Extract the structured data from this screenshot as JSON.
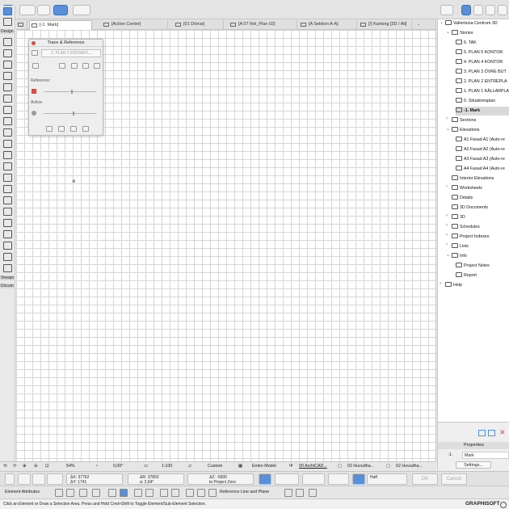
{
  "tabs": [
    {
      "label": "[-1. Mark]",
      "active": true
    },
    {
      "label": "[Action Center]"
    },
    {
      "label": "[01 Dörrar]"
    },
    {
      "label": "[A 07 Rel_Plan 02]"
    },
    {
      "label": "[A Sektion A-A]"
    },
    {
      "label": "[!] Kartong [3D / All]"
    }
  ],
  "toolbox": {
    "design_label": "Design",
    "viewpoint_label": "Viewpo",
    "document_label": "Docum"
  },
  "palette": {
    "title": "Trace & Reference",
    "reference_source": "2. PLAN 2 ENTRÉPL...",
    "reference_label": "Reference:",
    "active_label": "Active:"
  },
  "navigator": {
    "project": "Vallentuna Centrum 3D",
    "stories_label": "Stories",
    "stories": [
      "6. TAK",
      "5. PLAN 5 KONTOR",
      "4. PLAN 4 KONTOR",
      "3. PLAN 3 ÖVRE BUT",
      "2. PLAN 2 ENTRÉPLA",
      "1. PLAN 1 KÄLLARPLA",
      "0. Situationsplan",
      "-1. Mark"
    ],
    "selected_story": "-1. Mark",
    "sections_label": "Sections",
    "elevations_label": "Elevations",
    "elevations": [
      "A1 Fasad A1 (Auto-re",
      "A2 Fasad A2 (Auto-re",
      "A3 Fasad A3 (Auto-re",
      "A4 Fasad A4 (Auto-re"
    ],
    "other": [
      "Interior Elevations",
      "Worksheets",
      "Details",
      "3D Documents",
      "3D",
      "Schedules",
      "Project Indexes",
      "Lists",
      "Info"
    ],
    "info_children": [
      "Project Notes",
      "Report"
    ],
    "help_label": "Help"
  },
  "properties": {
    "title": "Properties",
    "id": "-1.",
    "name": "Mark",
    "settings_label": "Settings..."
  },
  "zoombar": {
    "zoom": "54%",
    "angle": "0,00°",
    "scale": "1:100",
    "layer_combo": "Custom",
    "model_view": "Entire Model",
    "pen_set": "00 ArchiCAD...",
    "view1": "02 Huvudha...",
    "view2": "02 Huvudha..."
  },
  "infobox": {
    "dx": "ΔX: 37762",
    "dy": "ΔY: 1741",
    "dr": "ΔR: 37802",
    "da": "α: 2,64°",
    "dz": "ΔZ: -5000",
    "to_zero": "to Project Zero",
    "half": "Half",
    "ok": "OK",
    "cancel": "Cancel"
  },
  "attrbar": {
    "element_attributes": "Element Attributes",
    "reference_plane": "Reference Line and Plane"
  },
  "status": {
    "message": "Click an Element or Draw a Selection Area. Press and Hold Cmd+Shift to Toggle Element/Sub-Element Selection.",
    "brand": "GRAPHISOFT"
  },
  "colors": {
    "accent": "#5b8fd8",
    "close": "#e2463f",
    "selected_row": "#d9d9d9"
  }
}
